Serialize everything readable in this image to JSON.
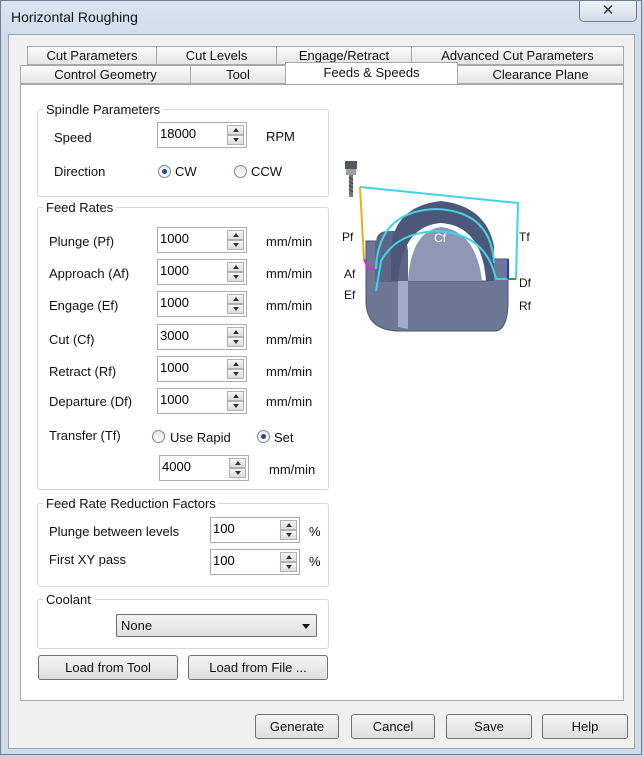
{
  "window": {
    "title": "Horizontal Roughing",
    "close_glyph": "✕"
  },
  "tabs_row1": [
    {
      "label": "Cut Parameters"
    },
    {
      "label": "Cut Levels"
    },
    {
      "label": "Engage/Retract"
    },
    {
      "label": "Advanced Cut Parameters"
    }
  ],
  "tabs_row2": [
    {
      "label": "Control Geometry"
    },
    {
      "label": "Tool"
    },
    {
      "label": "Feeds & Speeds",
      "active": true
    },
    {
      "label": "Clearance Plane"
    }
  ],
  "spindle": {
    "title": "Spindle Parameters",
    "speed_label": "Speed",
    "speed_value": "18000",
    "speed_unit": "RPM",
    "direction_label": "Direction",
    "cw_label": "CW",
    "ccw_label": "CCW",
    "direction_selected": "CW"
  },
  "feed_rates": {
    "title": "Feed Rates",
    "rows": [
      {
        "label": "Plunge (Pf)",
        "value": "1000",
        "unit": "mm/min"
      },
      {
        "label": "Approach (Af)",
        "value": "1000",
        "unit": "mm/min"
      },
      {
        "label": "Engage (Ef)",
        "value": "1000",
        "unit": "mm/min"
      },
      {
        "label": "Cut (Cf)",
        "value": "3000",
        "unit": "mm/min"
      },
      {
        "label": "Retract (Rf)",
        "value": "1000",
        "unit": "mm/min"
      },
      {
        "label": "Departure  (Df)",
        "value": "1000",
        "unit": "mm/min"
      }
    ],
    "transfer_label": "Transfer (Tf)",
    "use_rapid_label": "Use Rapid",
    "set_label": "Set",
    "transfer_selected": "Set",
    "transfer_value": "4000",
    "transfer_unit": "mm/min"
  },
  "reduction": {
    "title": "Feed Rate Reduction Factors",
    "plunge_label": "Plunge between levels",
    "plunge_value": "100",
    "firstxy_label": "First XY pass",
    "firstxy_value": "100",
    "unit": "%"
  },
  "coolant": {
    "title": "Coolant",
    "selected": "None"
  },
  "load_from_tool": "Load from Tool",
  "load_from_file": "Load from File ...",
  "buttons": {
    "generate": "Generate",
    "cancel": "Cancel",
    "save": "Save",
    "help": "Help"
  },
  "diagram": {
    "labels": {
      "pf": "Pf",
      "af": "Af",
      "ef": "Ef",
      "cf": "Cf",
      "tf": "Tf",
      "df": "Df",
      "rf": "Rf"
    },
    "colors": {
      "part": "#5b6586",
      "part_light": "#a3abc7",
      "transfer": "#3fd3e6",
      "plunge": "#e2b21a",
      "approach": "#d12fd0",
      "retract": "#2436d6",
      "depart": "#2fa02f"
    }
  }
}
